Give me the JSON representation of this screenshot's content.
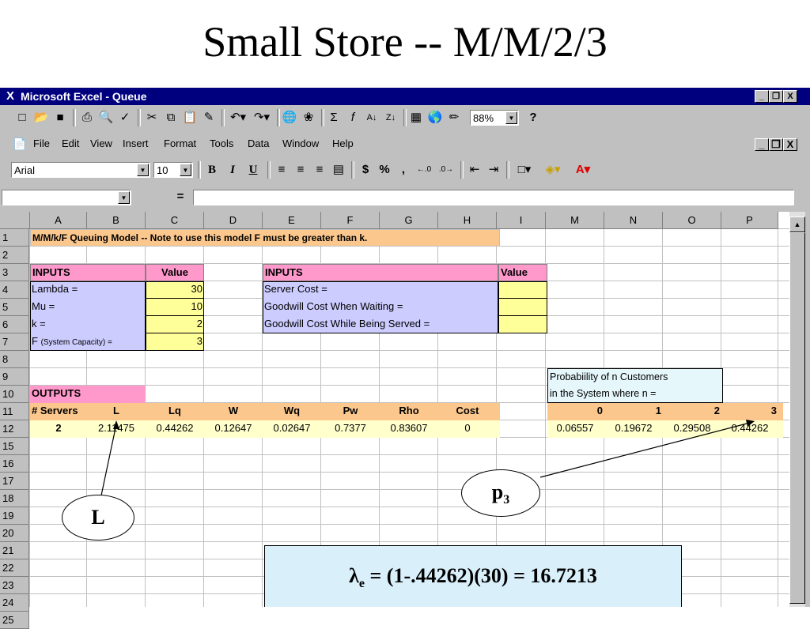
{
  "slide_title": "Small Store -- M/M/2/3",
  "window": {
    "title": "Microsoft Excel - Queue",
    "controls": [
      "_",
      "❐",
      "X"
    ]
  },
  "menu": [
    "File",
    "Edit",
    "View",
    "Insert",
    "Format",
    "Tools",
    "Data",
    "Window",
    "Help"
  ],
  "toolbar": {
    "zoom": "88%",
    "font": "Arial",
    "font_size": "10",
    "bold": "B",
    "italic": "I",
    "underline": "U",
    "currency": "$",
    "percent": "%",
    "comma": ",",
    "equals": "="
  },
  "columns": [
    "A",
    "B",
    "C",
    "D",
    "E",
    "F",
    "G",
    "H",
    "I",
    "M",
    "N",
    "O",
    "P"
  ],
  "rows": [
    "1",
    "2",
    "3",
    "4",
    "5",
    "6",
    "7",
    "8",
    "9",
    "10",
    "11",
    "12",
    "15",
    "16",
    "17",
    "18",
    "19",
    "20",
    "21",
    "22",
    "23",
    "24",
    "25"
  ],
  "sheet": {
    "r1": "M/M/k/F Queuing Model  -- Note to use this model F must be greater than k.",
    "inputs_header": "INPUTS",
    "value_header": "Value",
    "lambda_label": "Lambda =",
    "lambda_value": "30",
    "mu_label": "Mu =",
    "mu_value": "10",
    "k_label": "k =",
    "k_value": "2",
    "f_label_1": "F ",
    "f_label_2": "(System Capacity) =",
    "f_value": "3",
    "inputs2_header": "INPUTS",
    "value2_header": "Value",
    "server_cost": "Server Cost =",
    "goodwill_wait": "Goodwill Cost When Waiting =",
    "goodwill_served": "Goodwill Cost While Being Served =",
    "prob_line1": "Probabiility of n Customers",
    "prob_line2": "in the System where n =",
    "outputs": "OUTPUTS",
    "out_headers": [
      "# Servers",
      "L",
      "Lq",
      "W",
      "Wq",
      "Pw",
      "Rho",
      "Cost"
    ],
    "out_values": [
      "2",
      "2.11475",
      "0.44262",
      "0.12647",
      "0.02647",
      "0.7377",
      "0.83607",
      "0"
    ],
    "n_headers": [
      "0",
      "1",
      "2",
      "3"
    ],
    "p_values": [
      "0.06557",
      "0.19672",
      "0.29508",
      "0.44262"
    ]
  },
  "callouts": {
    "L": "L",
    "p3_base": "p",
    "p3_sub": "3",
    "formula_pre": "λ",
    "formula_sub": "e",
    "formula_post": " = (1-.44262)(30) = 16.7213"
  },
  "colors": {
    "orange": "#fbc78d",
    "pink": "#ff99cc",
    "lavender": "#ccccff",
    "yellow": "#ffff99",
    "cream": "#ffffcc",
    "title_blue": "#00007f"
  }
}
